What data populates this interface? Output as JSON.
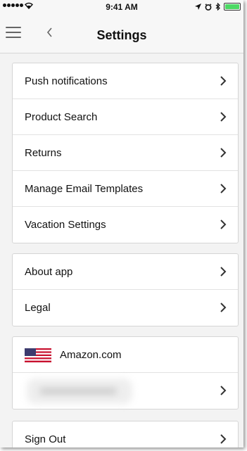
{
  "status_bar": {
    "time": "9:41 AM",
    "signal_bars": 5,
    "battery_level": 1.0,
    "battery_color": "#4cd964"
  },
  "header": {
    "title": "Settings",
    "menu_icon": "hamburger-menu-icon",
    "back_icon": "chevron-left-icon"
  },
  "sections": {
    "main": {
      "items": [
        {
          "label": "Push notifications"
        },
        {
          "label": "Product Search"
        },
        {
          "label": "Returns"
        },
        {
          "label": "Manage Email Templates"
        },
        {
          "label": "Vacation Settings"
        }
      ]
    },
    "info": {
      "items": [
        {
          "label": "About app"
        },
        {
          "label": "Legal"
        }
      ]
    },
    "store": {
      "flag_icon": "us-flag-icon",
      "name": "Amazon.com",
      "account_redacted": true
    },
    "account": {
      "sign_out_label": "Sign Out"
    }
  },
  "colors": {
    "background": "#f3f3f3",
    "card": "#ffffff",
    "divider": "#e2e2e2",
    "chevron": "#333333"
  }
}
